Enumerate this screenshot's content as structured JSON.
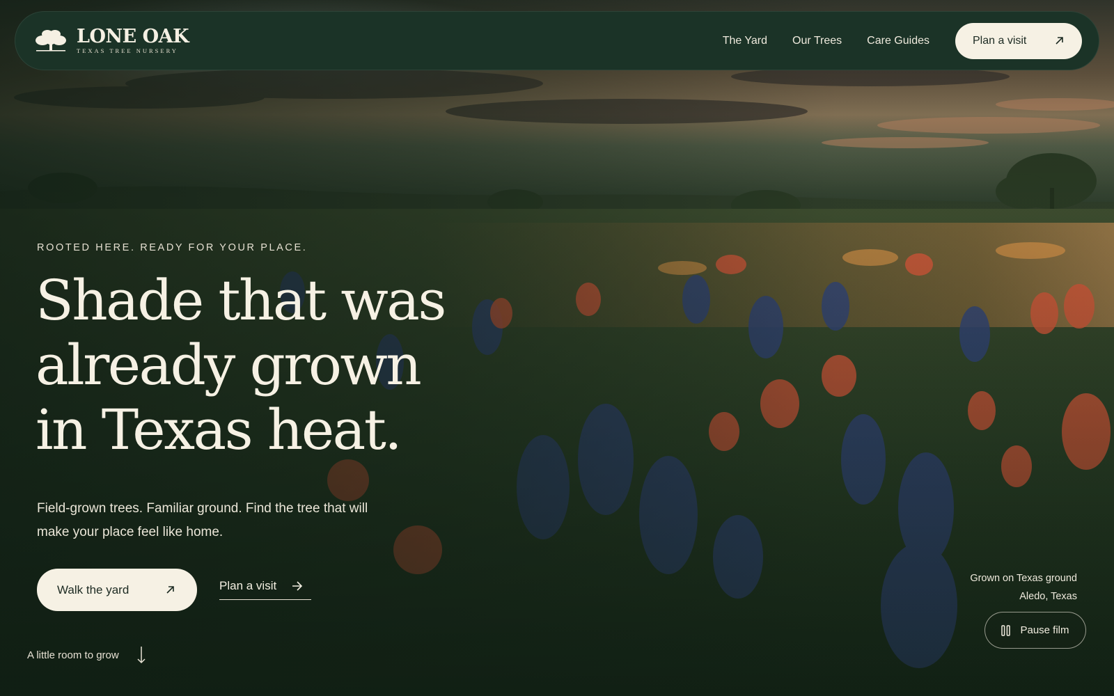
{
  "brand": {
    "name": "LONE OAK",
    "tagline": "TEXAS TREE NURSERY"
  },
  "nav": {
    "links": [
      "The Yard",
      "Our Trees",
      "Care Guides"
    ],
    "cta_label": "Plan a visit"
  },
  "hero": {
    "eyebrow": "ROOTED HERE. READY FOR YOUR PLACE.",
    "headline_lines": [
      "Shade that was",
      "already grown",
      "in Texas heat."
    ],
    "body": "Field-grown trees. Familiar ground. Find the tree that will make your place feel like home.",
    "primary_cta": "Walk the yard",
    "secondary_cta": "Plan a visit",
    "scroll_hint": "A little room to grow"
  },
  "caption": {
    "line1": "Grown on Texas ground",
    "line2": "Aledo, Texas"
  },
  "media": {
    "pause_label": "Pause film"
  },
  "colors": {
    "nav_bg": "#1b3327",
    "cream": "#f6f1e4",
    "text_dark": "#1c2a22"
  },
  "icons": {
    "brand": "oak-tree-icon",
    "nav_cta": "arrow-up-right-icon",
    "primary_cta": "arrow-up-right-icon",
    "secondary_cta": "arrow-right-icon",
    "scroll": "arrow-down-icon",
    "pause": "pause-icon"
  }
}
